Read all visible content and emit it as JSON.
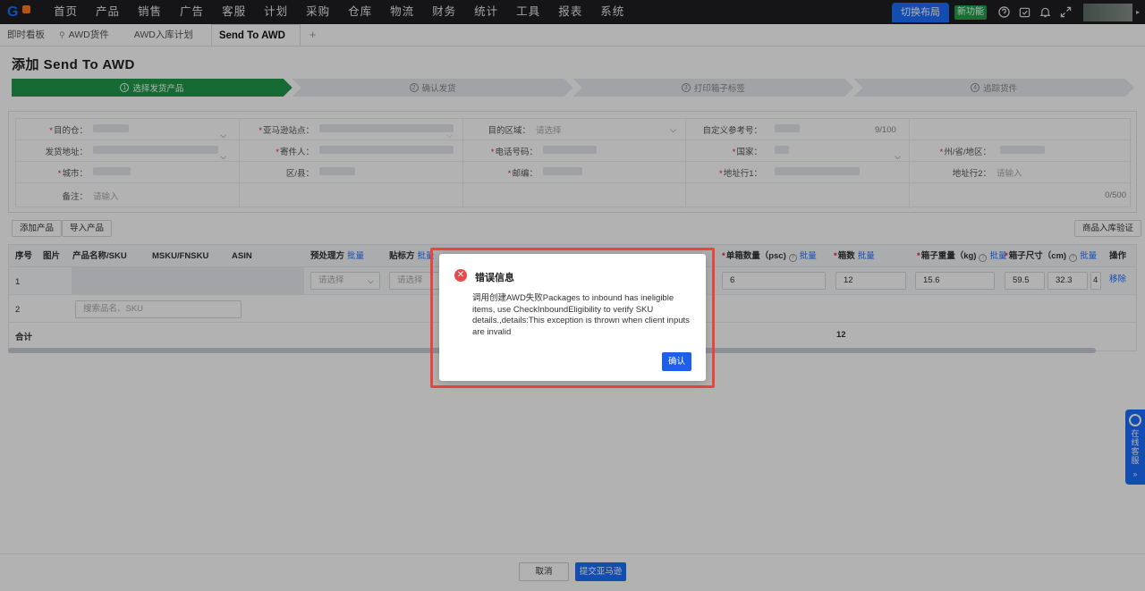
{
  "logo": {
    "letter": "G"
  },
  "nav": {
    "items": [
      "首页",
      "产品",
      "销售",
      "广告",
      "客服",
      "计划",
      "采购",
      "仓库",
      "物流",
      "财务",
      "统计",
      "工具",
      "报表",
      "系统"
    ],
    "switch_layout": "切换布局",
    "new_feature": "新功能"
  },
  "tabs": {
    "items": [
      "即时看板",
      "AWD货件",
      "AWD入库计划",
      "Send To AWD"
    ],
    "plus": "+"
  },
  "page": {
    "title": "添加 Send To AWD",
    "steps": [
      {
        "num": "1",
        "label": "选择发货产品"
      },
      {
        "num": "2",
        "label": "确认发货"
      },
      {
        "num": "3",
        "label": "打印箱子标签"
      },
      {
        "num": "4",
        "label": "追踪货件"
      }
    ]
  },
  "form": {
    "dest_warehouse": "目的仓：",
    "amazon_site": "亚马逊站点：",
    "dest_region": "目的区域：",
    "dest_region_ph": "请选择",
    "custom_ref": "自定义参考号：",
    "custom_ref_count": "9/100",
    "ship_address": "发货地址：",
    "sender": "寄件人：",
    "phone": "电话号码：",
    "country": "国家：",
    "state": "州/省/地区：",
    "city": "城市：",
    "district": "区/县：",
    "postcode": "邮编：",
    "address1": "地址行1：",
    "address2": "地址行2：",
    "address2_ph": "请输入",
    "note": "备注：",
    "note_ph": "请输入",
    "note_count": "0/500"
  },
  "toolbar": {
    "add_product": "添加产品",
    "import_product": "导入产品",
    "verify": "商品入库验证"
  },
  "table": {
    "headers": {
      "index": "序号",
      "image": "图片",
      "name_sku": "产品名称/SKU",
      "msku": "MSKU/FNSKU",
      "asin": "ASIN",
      "prep": "预处理方",
      "label_by": "贴标方",
      "units_per_box": "单箱数量（psc)",
      "boxes": "箱数",
      "box_weight": "箱子重量（kg)",
      "box_size": "箱子尺寸（cm)",
      "action": "操作",
      "batch": "批量"
    },
    "row1": {
      "index": "1",
      "prep_ph": "请选择",
      "label_ph": "请选择",
      "units": "6",
      "boxes": "12",
      "weight": "15.6",
      "size_l": "59.5",
      "size_w": "32.3",
      "size_h": "4",
      "action": "移除"
    },
    "row2": {
      "index": "2",
      "search_ph": "搜索品名、SKU"
    },
    "total": {
      "label": "合计",
      "boxes": "12"
    }
  },
  "footer": {
    "cancel": "取消",
    "submit": "提交亚马逊"
  },
  "side_widget": {
    "text": "在线客服",
    "arrow": "»"
  },
  "dialog": {
    "title": "错误信息",
    "message": "调用创建AWD失败Packages to inbound has ineligible items, use CheckInboundEligibility to verify SKU details.,details:This exception is thrown when client inputs are invalid",
    "confirm": "确认"
  },
  "colors": {
    "brand": "#1e6fff",
    "step_active": "#1f9a4a",
    "error": "#e84a4a",
    "highlight": "#e9473d"
  }
}
